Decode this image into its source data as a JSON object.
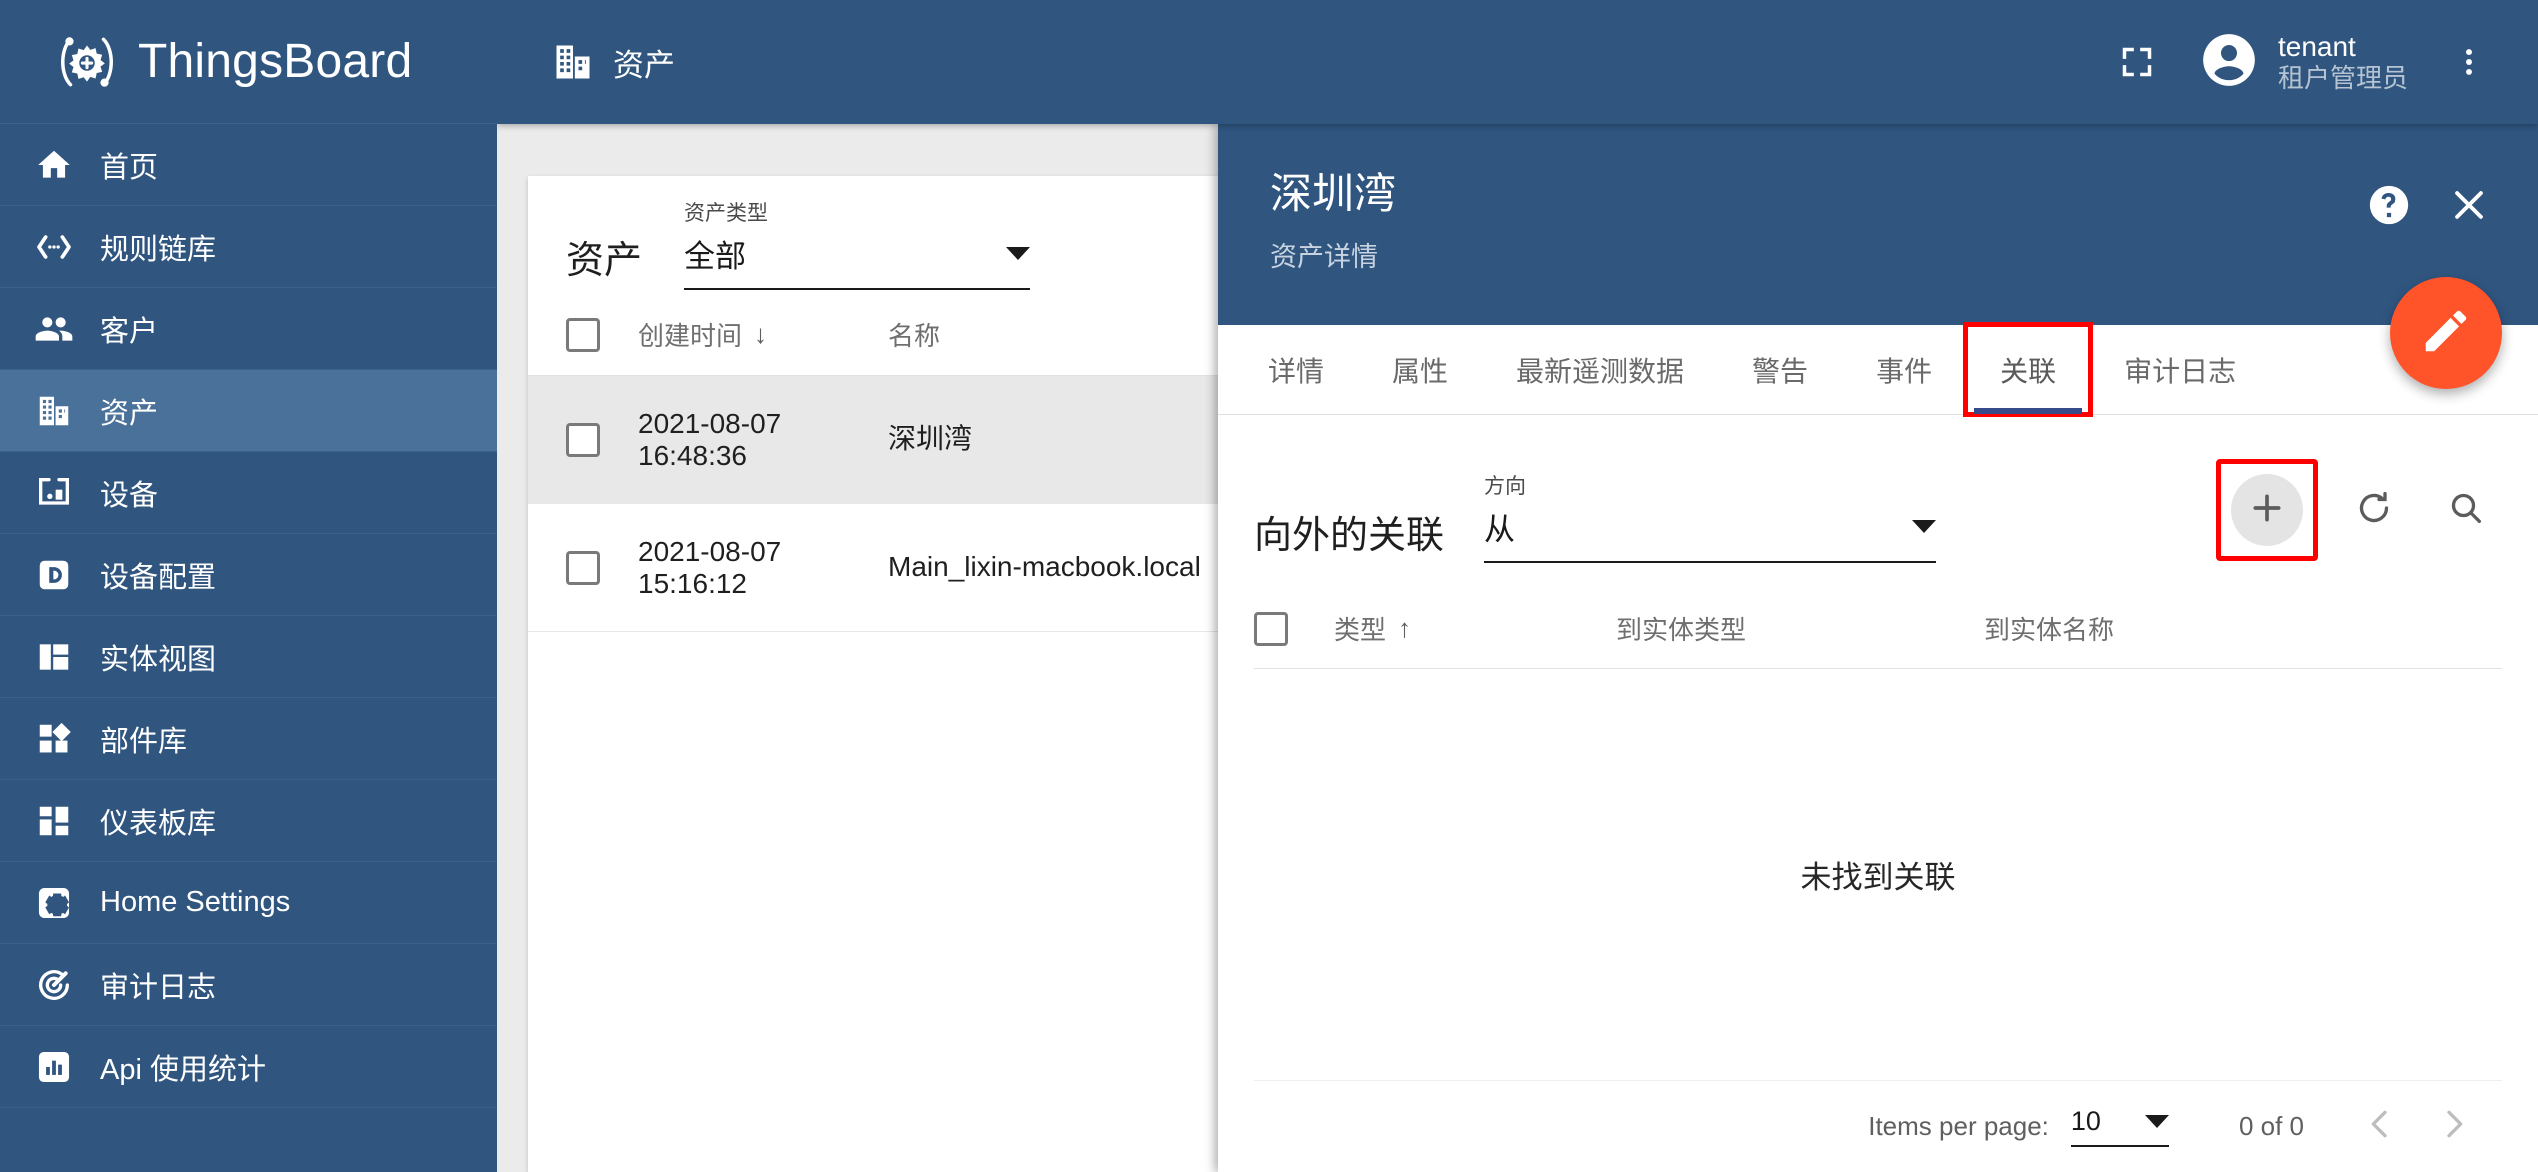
{
  "brand": {
    "name": "ThingsBoard",
    "logo_icon": "thingsboard-logo-icon"
  },
  "sidebar": {
    "items": [
      {
        "label": "首页",
        "icon": "home-icon",
        "key": "home",
        "active": false
      },
      {
        "label": "规则链库",
        "icon": "rule-chain-icon",
        "key": "rule-chains",
        "active": false
      },
      {
        "label": "客户",
        "icon": "customers-icon",
        "key": "customers",
        "active": false
      },
      {
        "label": "资产",
        "icon": "assets-icon",
        "key": "assets",
        "active": true
      },
      {
        "label": "设备",
        "icon": "devices-icon",
        "key": "devices",
        "active": false
      },
      {
        "label": "设备配置",
        "icon": "device-profiles-icon",
        "key": "device-profiles",
        "active": false
      },
      {
        "label": "实体视图",
        "icon": "entity-views-icon",
        "key": "entity-views",
        "active": false
      },
      {
        "label": "部件库",
        "icon": "widgets-icon",
        "key": "widgets",
        "active": false
      },
      {
        "label": "仪表板库",
        "icon": "dashboards-icon",
        "key": "dashboards",
        "active": false
      },
      {
        "label": "Home Settings",
        "icon": "settings-gear-icon",
        "key": "home-settings",
        "active": false
      },
      {
        "label": "审计日志",
        "icon": "audit-log-icon",
        "key": "audit-log",
        "active": false
      },
      {
        "label": "Api 使用统计",
        "icon": "api-usage-icon",
        "key": "api-usage",
        "active": false
      }
    ]
  },
  "topbar": {
    "title": "资产",
    "title_icon": "assets-icon",
    "fullscreen_icon": "fullscreen-icon",
    "avatar_icon": "account-circle-icon",
    "user_name": "tenant",
    "user_role": "租户管理员",
    "more_icon": "more-vert-icon"
  },
  "asset_list": {
    "title": "资产",
    "filter": {
      "label": "资产类型",
      "value": "全部",
      "caret_icon": "chevron-down-icon"
    },
    "columns": [
      {
        "key": "created",
        "label": "创建时间",
        "sorted": true,
        "sort_icon": "arrow-down-icon"
      },
      {
        "key": "name",
        "label": "名称",
        "sorted": false
      }
    ],
    "rows": [
      {
        "created": "2021-08-07 16:48:36",
        "name": "深圳湾",
        "selected": true
      },
      {
        "created": "2021-08-07 15:16:12",
        "name": "Main_lixin-macbook.local",
        "selected": false
      }
    ]
  },
  "detail": {
    "title": "深圳湾",
    "subtitle": "资产详情",
    "help_icon": "help-circle-icon",
    "close_icon": "close-icon",
    "edit_fab_icon": "pencil-icon",
    "tabs": [
      {
        "label": "详情",
        "active": false,
        "highlighted": false
      },
      {
        "label": "属性",
        "active": false,
        "highlighted": false
      },
      {
        "label": "最新遥测数据",
        "active": false,
        "highlighted": false
      },
      {
        "label": "警告",
        "active": false,
        "highlighted": false
      },
      {
        "label": "事件",
        "active": false,
        "highlighted": false
      },
      {
        "label": "关联",
        "active": true,
        "highlighted": true
      },
      {
        "label": "审计日志",
        "active": false,
        "highlighted": false
      }
    ]
  },
  "relations": {
    "title": "向外的关联",
    "direction": {
      "label": "方向",
      "value": "从",
      "caret_icon": "chevron-down-icon"
    },
    "actions": [
      {
        "name": "add-relation-button",
        "icon": "plus-icon",
        "highlighted": true,
        "hovered": true
      },
      {
        "name": "refresh-button",
        "icon": "refresh-icon",
        "highlighted": false,
        "hovered": false
      },
      {
        "name": "search-button",
        "icon": "search-icon",
        "highlighted": false,
        "hovered": false
      }
    ],
    "columns": [
      {
        "key": "type",
        "label": "类型",
        "sorted": true,
        "sort_icon": "arrow-up-icon"
      },
      {
        "key": "to_entity_type",
        "label": "到实体类型",
        "sorted": false
      },
      {
        "key": "to_entity_name",
        "label": "到实体名称",
        "sorted": false
      }
    ],
    "rows": [],
    "empty_text": "未找到关联",
    "paginator": {
      "items_per_page_label": "Items per page:",
      "items_per_page_value": "10",
      "caret_icon": "chevron-down-icon",
      "range_label": "0 of 0",
      "prev_icon": "chevron-left-icon",
      "next_icon": "chevron-right-icon"
    }
  },
  "colors": {
    "primary": "#305680",
    "sidebar_active": "#4a719a",
    "accent_fab": "#ff5429",
    "highlight_box": "#ff0000",
    "tab_underline": "#36498a",
    "content_bg": "#ebebeb"
  }
}
